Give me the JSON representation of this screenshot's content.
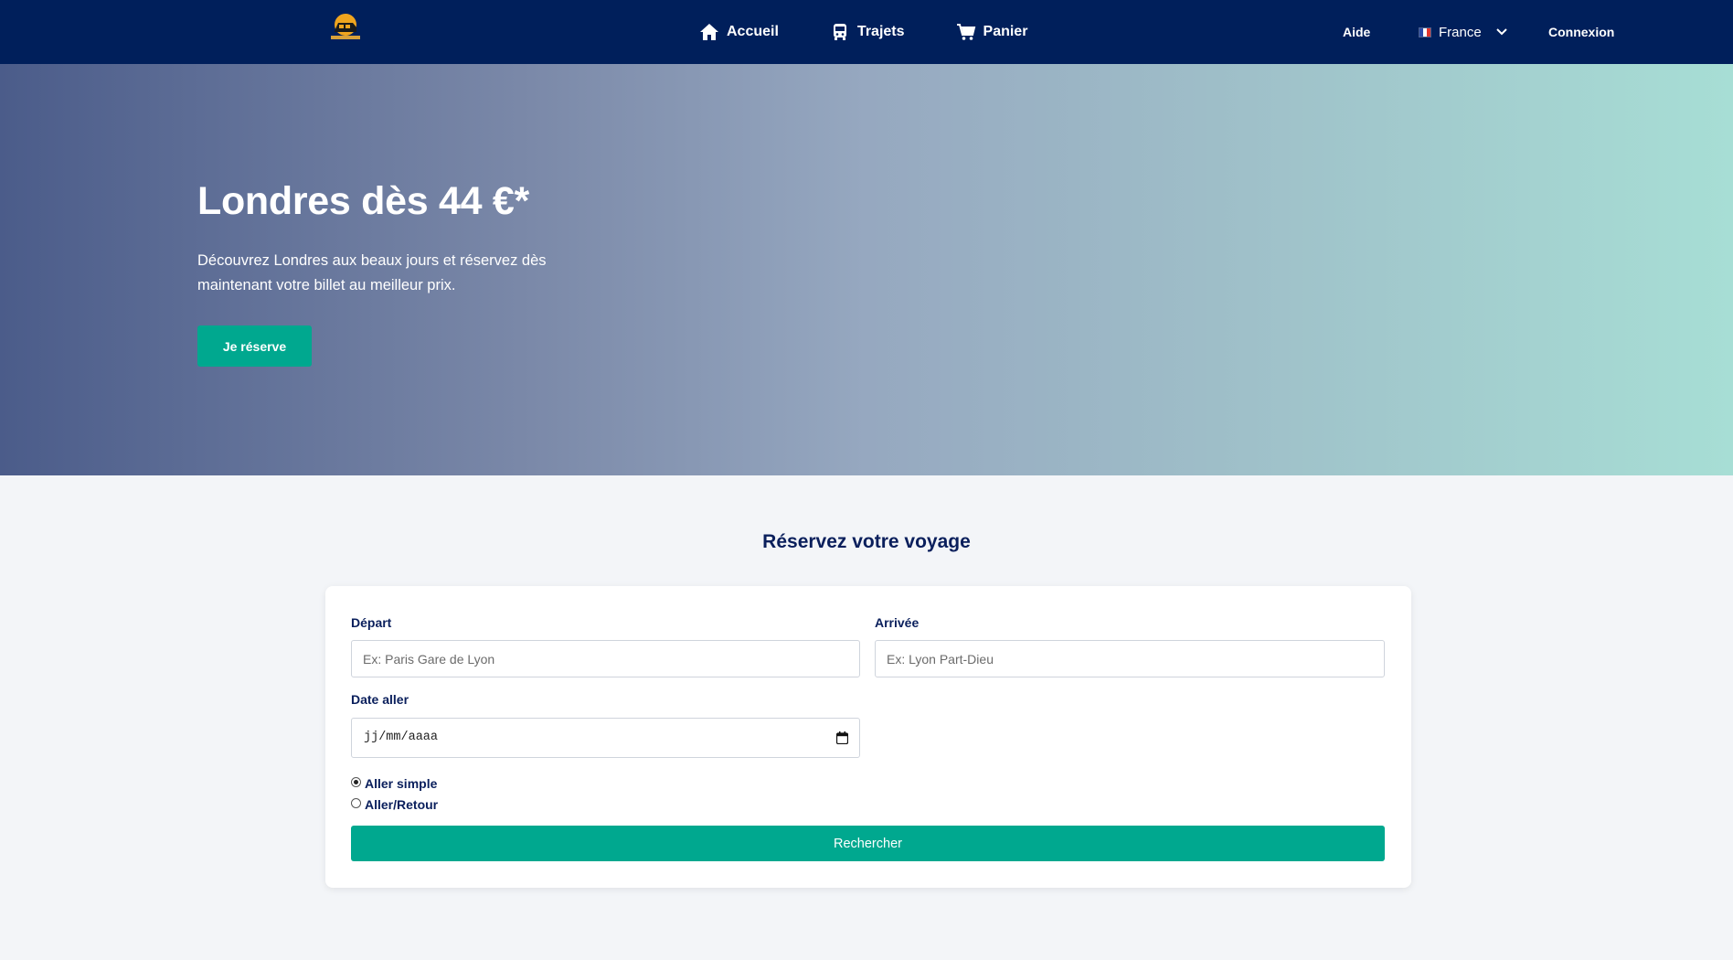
{
  "nav": {
    "links": [
      {
        "label": "Accueil",
        "icon": "home-icon"
      },
      {
        "label": "Trajets",
        "icon": "bus-icon"
      },
      {
        "label": "Panier",
        "icon": "cart-icon"
      }
    ],
    "help": "Aide",
    "language": {
      "label": "France",
      "flag": "france-flag-icon"
    },
    "login": "Connexion"
  },
  "hero": {
    "title": "Londres dès 44 €*",
    "description": "Découvrez Londres aux beaux jours et réservez dès maintenant votre billet au meilleur prix.",
    "cta": "Je réserve"
  },
  "booking": {
    "title": "Réservez votre voyage",
    "departure": {
      "label": "Départ",
      "placeholder": "Ex: Paris Gare de Lyon"
    },
    "arrival": {
      "label": "Arrivée",
      "placeholder": "Ex: Lyon Part-Dieu"
    },
    "date": {
      "label": "Date aller",
      "value": "jj/mm/aaaa"
    },
    "trip_types": [
      {
        "label": "Aller simple",
        "selected": true
      },
      {
        "label": "Aller/Retour",
        "selected": false
      }
    ],
    "search": "Rechercher"
  },
  "colors": {
    "navbar": "#001f5b",
    "accent": "#00a88f",
    "heading": "#0a1f5c",
    "page_background": "#f3f5f8"
  }
}
